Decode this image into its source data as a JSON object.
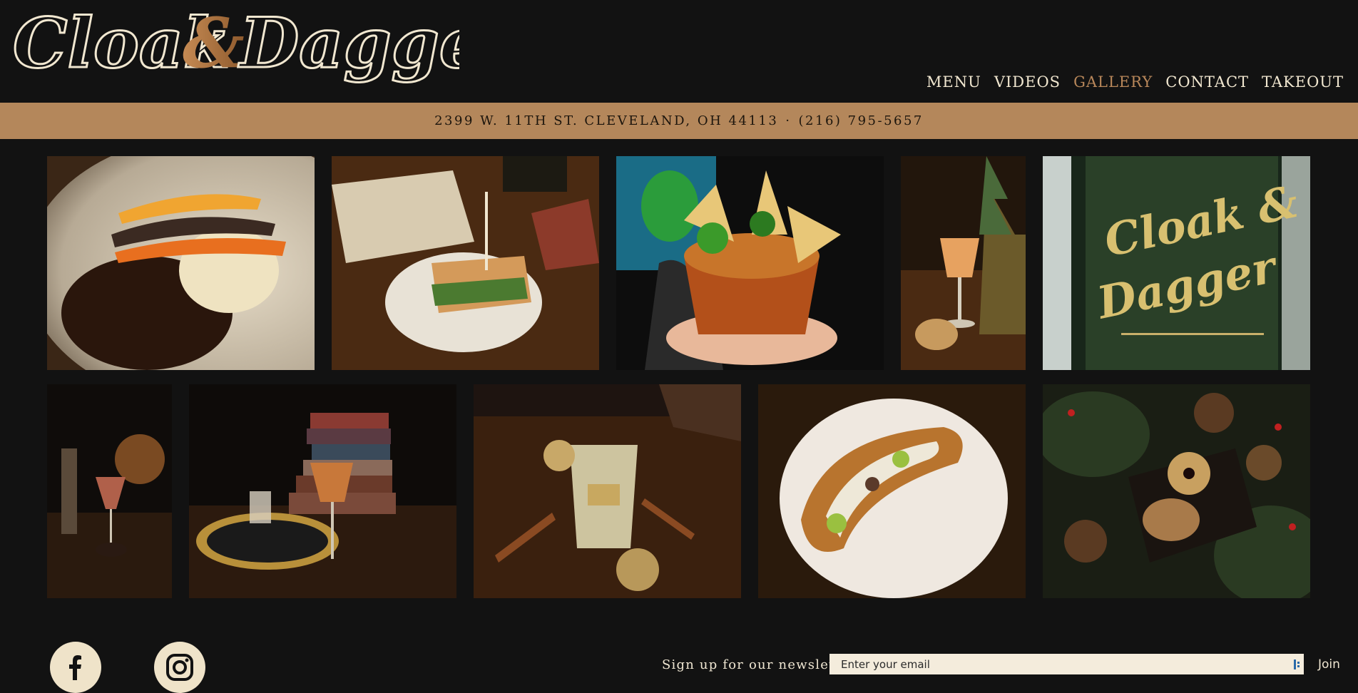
{
  "brand": {
    "logo_text": "Cloak & Dagger",
    "colors": {
      "cream": "#f1e7d0",
      "copper": "#b4875b",
      "background": "#121212"
    }
  },
  "nav": {
    "items": [
      {
        "label": "MENU"
      },
      {
        "label": "VIDEOS"
      },
      {
        "label": "GALLERY",
        "active": true
      },
      {
        "label": "CONTACT"
      },
      {
        "label": "TAKEOUT"
      }
    ]
  },
  "address_bar": {
    "address": "2399 W. 11TH ST. CLEVELAND, OH 44113",
    "separator": "·",
    "phone": "(216) 795-5657"
  },
  "gallery": {
    "photos": [
      {
        "subject": "short rib with roasted carrots and mashed potatoes"
      },
      {
        "subject": "toasted sandwich on plate with open book"
      },
      {
        "subject": "hand holding bowl of chickpea curry with chips"
      },
      {
        "subject": "cocktail with pineapple and ginger"
      },
      {
        "subject": "Cloak & Dagger cocktail lounge window sign"
      },
      {
        "subject": "cocktail with globe on bar"
      },
      {
        "subject": "cocktail with stacked books and mirror tray"
      },
      {
        "subject": "highball cocktail with dried apple and cinnamon"
      },
      {
        "subject": "hoagie sandwich with peppers on plate"
      },
      {
        "subject": "nut board with pine branches and pinecones"
      }
    ]
  },
  "footer": {
    "social": [
      {
        "icon": "facebook-icon"
      },
      {
        "icon": "instagram-icon"
      }
    ],
    "newsletter_label": "Sign up for our newsletter",
    "email_placeholder": "Enter your email",
    "join_label": "Join"
  }
}
